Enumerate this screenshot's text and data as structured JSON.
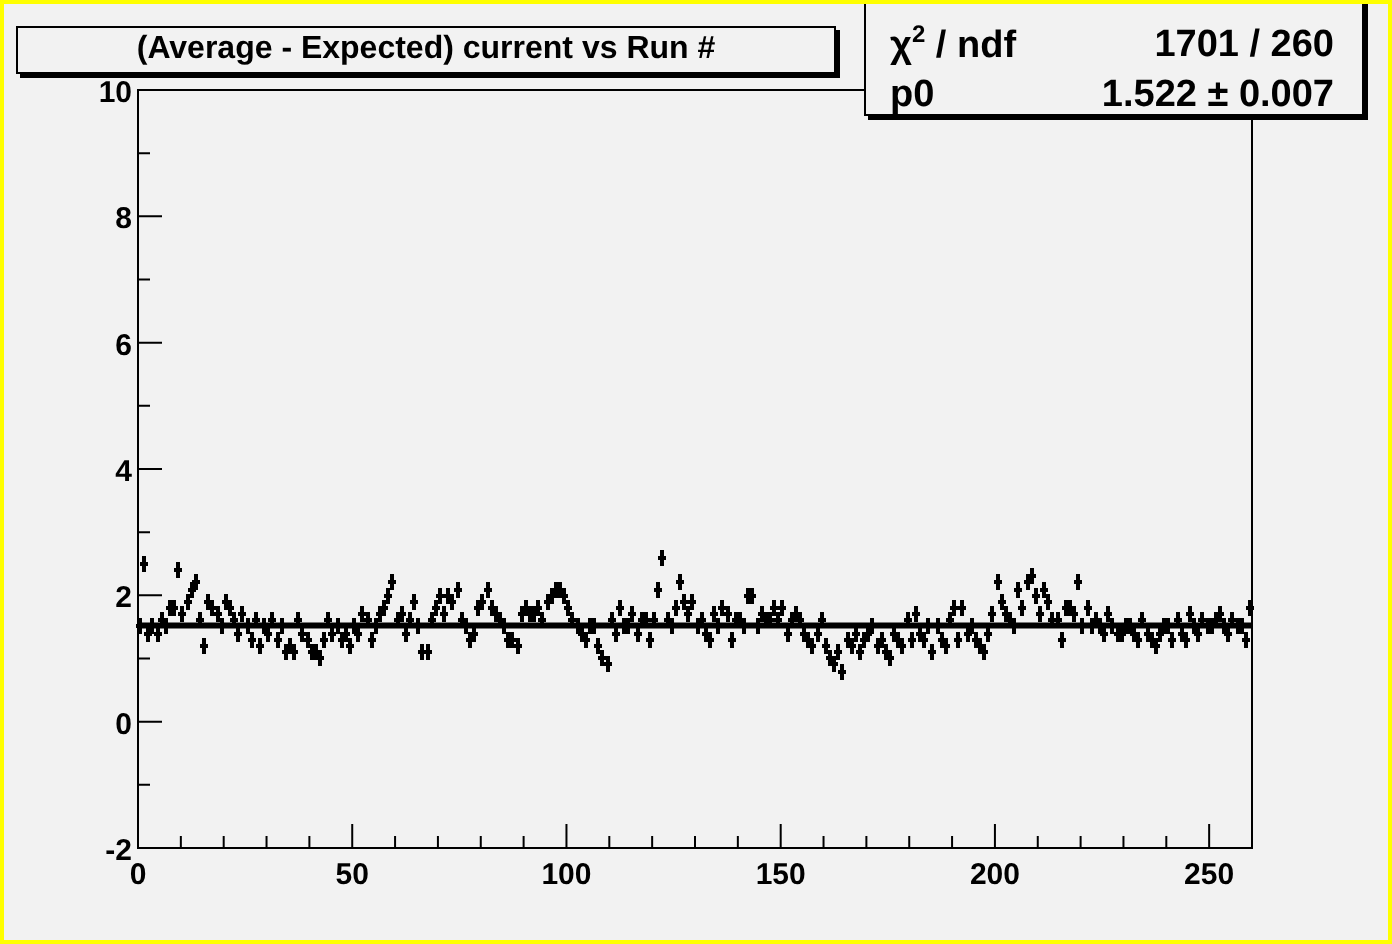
{
  "title": "(Average - Expected) current vs Run #",
  "stats": [
    {
      "label": "χ$^{2}$ / ndf",
      "value": "1701 / 260"
    },
    {
      "label": "p0",
      "value": "1.522 ± 0.007"
    }
  ],
  "chart_data": {
    "type": "scatter",
    "xlim": [
      0,
      260
    ],
    "ylim": [
      -2,
      10
    ],
    "xticks": [
      0,
      50,
      100,
      150,
      200,
      250
    ],
    "yticks": [
      -2,
      0,
      2,
      4,
      6,
      8,
      10
    ],
    "x": [
      0.5,
      1.5,
      2.5,
      3.5,
      4.5,
      5.5,
      6.5,
      7.5,
      8.5,
      9.5,
      10.5,
      11.5,
      12.5,
      13.5,
      14.5,
      15.5,
      16.5,
      17.5,
      18.5,
      19.5,
      20.5,
      21.5,
      22.5,
      23.5,
      24.5,
      25.5,
      26.5,
      27.5,
      28.5,
      29.5,
      30.5,
      31.5,
      32.5,
      33.5,
      34.5,
      35.5,
      36.5,
      37.5,
      38.5,
      39.5,
      40.5,
      41.5,
      42.5,
      43.5,
      44.5,
      45.5,
      46.5,
      47.5,
      48.5,
      49.5,
      50.5,
      51.5,
      52.5,
      53.5,
      54.5,
      55.5,
      56.5,
      57.5,
      58.5,
      59.5,
      60.5,
      61.5,
      62.5,
      63.5,
      64.5,
      65.5,
      66.5,
      67.5,
      68.5,
      69.5,
      70.5,
      71.5,
      72.5,
      73.5,
      74.5,
      75.5,
      76.5,
      77.5,
      78.5,
      79.5,
      80.5,
      81.5,
      82.5,
      83.5,
      84.5,
      85.5,
      86.5,
      87.5,
      88.5,
      89.5,
      90.5,
      91.5,
      92.5,
      93.5,
      94.5,
      95.5,
      96.5,
      97.5,
      98.5,
      99.5,
      100.5,
      101.5,
      102.5,
      103.5,
      104.5,
      105.5,
      106.5,
      107.5,
      108.5,
      109.5,
      110.5,
      111.5,
      112.5,
      113.5,
      114.5,
      115.5,
      116.5,
      117.5,
      118.5,
      119.5,
      120.5,
      121.5,
      122.5,
      123.5,
      124.5,
      125.5,
      126.5,
      127.5,
      128.5,
      129.5,
      130.5,
      131.5,
      132.5,
      133.5,
      134.5,
      135.5,
      136.5,
      137.5,
      138.5,
      139.5,
      140.5,
      141.5,
      142.5,
      143.5,
      144.5,
      145.5,
      146.5,
      147.5,
      148.5,
      149.5,
      150.5,
      151.5,
      152.5,
      153.5,
      154.5,
      155.5,
      156.5,
      157.5,
      158.5,
      159.5,
      160.5,
      161.5,
      162.5,
      163.5,
      164.5,
      165.5,
      166.5,
      167.5,
      168.5,
      169.5,
      170.5,
      171.5,
      172.5,
      173.5,
      174.5,
      175.5,
      176.5,
      177.5,
      178.5,
      179.5,
      180.5,
      181.5,
      182.5,
      183.5,
      184.5,
      185.5,
      186.5,
      187.5,
      188.5,
      189.5,
      190.5,
      191.5,
      192.5,
      193.5,
      194.5,
      195.5,
      196.5,
      197.5,
      198.5,
      199.5,
      200.5,
      201.5,
      202.5,
      203.5,
      204.5,
      205.5,
      206.5,
      207.5,
      208.5,
      209.5,
      210.5,
      211.5,
      212.5,
      213.5,
      214.5,
      215.5,
      216.5,
      217.5,
      218.5,
      219.5,
      220.5,
      221.5,
      222.5,
      223.5,
      224.5,
      225.5,
      226.5,
      227.5,
      228.5,
      229.5,
      230.5,
      231.5,
      232.5,
      233.5,
      234.5,
      235.5,
      236.5,
      237.5,
      238.5,
      239.5,
      240.5,
      241.5,
      242.5,
      243.5,
      244.5,
      245.5,
      246.5,
      247.5,
      248.5,
      249.5,
      250.5,
      251.5,
      252.5,
      253.5,
      254.5,
      255.5,
      256.5,
      257.5,
      258.5,
      259.5
    ],
    "series": [
      {
        "color": "#000000",
        "values": [
          1.5,
          2.5,
          1.4,
          1.5,
          1.4,
          1.6,
          1.5,
          1.8,
          1.8,
          2.4,
          1.7,
          1.9,
          2.1,
          2.2,
          1.6,
          1.2,
          1.9,
          1.8,
          1.7,
          1.5,
          1.9,
          1.8,
          1.6,
          1.4,
          1.7,
          1.5,
          1.3,
          1.6,
          1.2,
          1.5,
          1.4,
          1.6,
          1.3,
          1.5,
          1.1,
          1.2,
          1.1,
          1.6,
          1.4,
          1.3,
          1.1,
          1.1,
          1.0,
          1.3,
          1.6,
          1.4,
          1.5,
          1.3,
          1.4,
          1.2,
          1.5,
          1.4,
          1.7,
          1.6,
          1.3,
          1.5,
          1.7,
          1.8,
          2.0,
          2.2,
          1.6,
          1.7,
          1.4,
          1.6,
          1.9,
          1.5,
          1.1,
          1.1,
          1.6,
          1.8,
          2.0,
          1.7,
          2.0,
          1.9,
          2.1,
          1.6,
          1.5,
          1.3,
          1.4,
          1.8,
          1.9,
          2.1,
          1.8,
          1.7,
          1.6,
          1.5,
          1.3,
          1.3,
          1.2,
          1.7,
          1.8,
          1.7,
          1.7,
          1.8,
          1.6,
          1.9,
          2.0,
          2.1,
          2.1,
          2.0,
          1.8,
          1.6,
          1.5,
          1.4,
          1.3,
          1.5,
          1.5,
          1.2,
          1.0,
          0.9,
          1.6,
          1.4,
          1.8,
          1.5,
          1.5,
          1.7,
          1.4,
          1.6,
          1.6,
          1.3,
          1.6,
          2.1,
          2.6,
          1.6,
          1.5,
          1.8,
          2.2,
          1.9,
          1.7,
          1.9,
          1.5,
          1.6,
          1.4,
          1.3,
          1.7,
          1.5,
          1.8,
          1.7,
          1.3,
          1.6,
          1.6,
          1.5,
          2.0,
          2.0,
          1.5,
          1.7,
          1.6,
          1.6,
          1.8,
          1.6,
          1.8,
          1.4,
          1.6,
          1.7,
          1.6,
          1.4,
          1.3,
          1.2,
          1.4,
          1.6,
          1.2,
          1.0,
          0.9,
          1.1,
          0.8,
          1.3,
          1.2,
          1.4,
          1.1,
          1.3,
          1.4,
          1.5,
          1.2,
          1.3,
          1.1,
          1.0,
          1.4,
          1.3,
          1.2,
          1.6,
          1.3,
          1.7,
          1.4,
          1.3,
          1.5,
          1.1,
          1.5,
          1.3,
          1.2,
          1.6,
          1.8,
          1.3,
          1.8,
          1.4,
          1.5,
          1.3,
          1.2,
          1.1,
          1.4,
          1.7,
          2.2,
          1.9,
          1.7,
          1.6,
          1.5,
          2.1,
          1.8,
          2.2,
          2.3,
          2.0,
          1.7,
          2.1,
          1.9,
          1.6,
          1.6,
          1.3,
          1.8,
          1.8,
          1.7,
          2.2,
          1.5,
          1.8,
          1.5,
          1.6,
          1.5,
          1.4,
          1.7,
          1.5,
          1.4,
          1.4,
          1.5,
          1.5,
          1.4,
          1.3,
          1.6,
          1.4,
          1.3,
          1.2,
          1.4,
          1.5,
          1.5,
          1.3,
          1.6,
          1.4,
          1.3,
          1.7,
          1.5,
          1.4,
          1.6,
          1.5,
          1.5,
          1.6,
          1.7,
          1.5,
          1.4,
          1.6,
          1.5,
          1.5,
          1.3,
          1.8
        ]
      }
    ],
    "ref_lines": [
      {
        "axis": "y",
        "value": 1.522
      }
    ]
  }
}
